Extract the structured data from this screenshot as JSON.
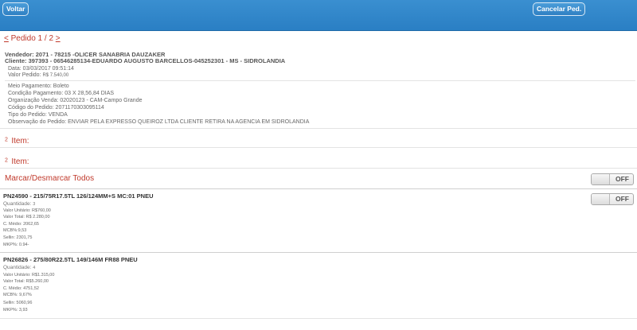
{
  "header": {
    "back_label": "Voltar",
    "cancel_label": "Cancelar Ped."
  },
  "nav": {
    "prev": "<",
    "title": "Pedido 1 / 2",
    "next": ">"
  },
  "order": {
    "vendedor": "Vendedor: 2071 - 78215 -OLICER SANABRIA DAUZAKER",
    "cliente": "Cliente: 397393 - 06546285134-EDUARDO AUGUSTO BARCELLOS-045252301 - MS - SIDROLANDIA",
    "data": "Data: 03/03/2017 09:51:14",
    "valor_label": "Valor Pedido:",
    "valor": "R$ 7.540,00",
    "meio_pagamento": "Meio Pagamento: Boleto",
    "condicao": "Condição Pagamento: 03 X 28,56,84 DIAS",
    "organizacao": "Organização Venda: 02020123 - CAM-Campo Grande",
    "codigo": "Código do Pedido: 2071170303095114",
    "tipo": "Tipo do Pedido: VENDA",
    "observacao": "Observação do Pedido: ENVIAR PELA EXPRESSO QUEIROZ LTDA CLIENTE RETIRA NA AGENCIA EM SIDROLANDIA"
  },
  "items_sections": [
    {
      "count": "2",
      "label": "Item:"
    },
    {
      "count": "2",
      "label": "Item:"
    }
  ],
  "mark_all": {
    "label": "Marcar/Desmarcar Todos",
    "toggle": "OFF"
  },
  "products": [
    {
      "title": "PN24590 - 215/75R17.5TL 126/124MM+S MC:01 PNEU",
      "quantidade_label": "Quantidade:",
      "quantidade": "3",
      "valor_unit_label": "Valor Unitário:",
      "valor_unit": "R$760,00",
      "valor_total_label": "Valor Total:",
      "valor_total": "R$ 2.280,00",
      "cmedio": "C. Médio: 2062,65",
      "mcb": "MCB%:9,53",
      "sellin": "Sellin: 2301,75",
      "mkp": "MKP%: 0.94-",
      "toggle": "OFF"
    },
    {
      "title": "PN26826 - 275/80R22.5TL 149/146M FR88 PNEU",
      "quantidade_label": "Quantidade:",
      "quantidade": "4",
      "valor_unit_label": "Valor Unitário:",
      "valor_unit": "R$1.315,00",
      "valor_total_label": "Valor Total:",
      "valor_total": "R$5.260,00",
      "cmedio": "C. Médio: 4751,52",
      "mcb": "MCB%: 9,67%",
      "sellin": "Sellin: 5060,96",
      "mkp": "MKP%: 3,93"
    }
  ]
}
